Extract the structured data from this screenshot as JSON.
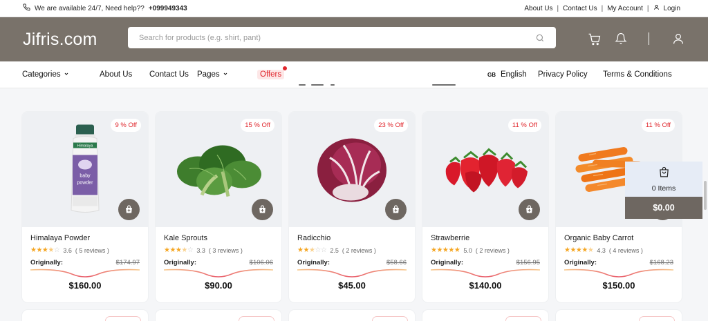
{
  "topbar": {
    "help_text": "We are available 24/7, Need help??",
    "phone": "+099949343",
    "links": [
      "About Us",
      "Contact Us",
      "My Account",
      "Login"
    ]
  },
  "header": {
    "logo": "Jifris.com",
    "search_placeholder": "Search for products (e.g. shirt, pant)"
  },
  "nav": {
    "categories": "Categories",
    "about": "About Us",
    "contact": "Contact Us",
    "pages": "Pages",
    "offers": "Offers",
    "language_flag": "GB",
    "language": "English",
    "privacy": "Privacy Policy",
    "terms": "Terms & Conditions"
  },
  "products": [
    {
      "name": "Himalaya Powder",
      "badge": "9 % Off",
      "rating": 3.6,
      "rating_text": "3.6",
      "reviews": "( 5 reviews )",
      "original_label": "Originally:",
      "original_price": "$174.97",
      "price": "$160.00"
    },
    {
      "name": "Kale Sprouts",
      "badge": "15 % Off",
      "rating": 3.3,
      "rating_text": "3.3",
      "reviews": "( 3 reviews )",
      "original_label": "Originally:",
      "original_price": "$106.06",
      "price": "$90.00"
    },
    {
      "name": "Radicchio",
      "badge": "23 % Off",
      "rating": 2.5,
      "rating_text": "2.5",
      "reviews": "( 2 reviews )",
      "original_label": "Originally:",
      "original_price": "$58.66",
      "price": "$45.00"
    },
    {
      "name": "Strawberrie",
      "badge": "11 % Off",
      "rating": 5.0,
      "rating_text": "5.0",
      "reviews": "( 2 reviews )",
      "original_label": "Originally:",
      "original_price": "$156.95",
      "price": "$140.00"
    },
    {
      "name": "Organic Baby Carrot",
      "badge": "11 % Off",
      "rating": 4.3,
      "rating_text": "4.3",
      "reviews": "( 4 reviews )",
      "original_label": "Originally:",
      "original_price": "$168.23",
      "price": "$150.00"
    }
  ],
  "floating_cart": {
    "items": "0 Items",
    "total": "$0.00"
  },
  "colors": {
    "header_bg": "#79726a",
    "accent_red": "#e0262c",
    "button_brown": "#6e6761",
    "star": "#f5a623"
  }
}
